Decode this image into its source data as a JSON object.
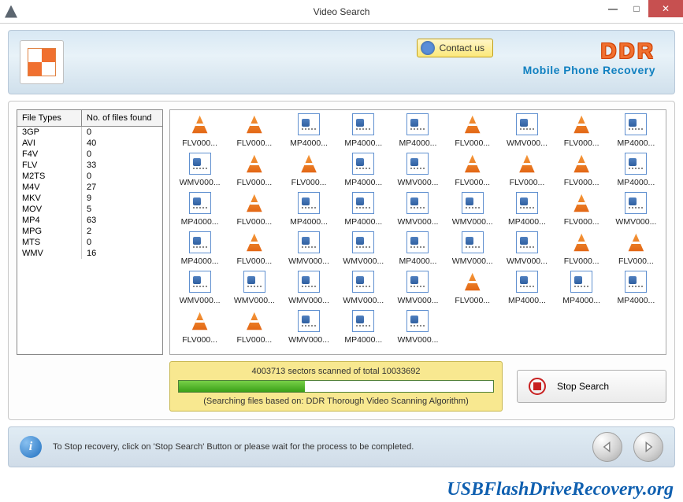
{
  "window": {
    "title": "Video Search"
  },
  "banner": {
    "contact_label": "Contact us",
    "brand_main": "DDR",
    "brand_sub": "Mobile Phone Recovery"
  },
  "file_types": {
    "header_type": "File Types",
    "header_count": "No. of files found",
    "rows": [
      {
        "type": "3GP",
        "count": "0"
      },
      {
        "type": "AVI",
        "count": "40"
      },
      {
        "type": "F4V",
        "count": "0"
      },
      {
        "type": "FLV",
        "count": "33"
      },
      {
        "type": "M2TS",
        "count": "0"
      },
      {
        "type": "M4V",
        "count": "27"
      },
      {
        "type": "MKV",
        "count": "9"
      },
      {
        "type": "MOV",
        "count": "5"
      },
      {
        "type": "MP4",
        "count": "63"
      },
      {
        "type": "MPG",
        "count": "2"
      },
      {
        "type": "MTS",
        "count": "0"
      },
      {
        "type": "WMV",
        "count": "16"
      }
    ]
  },
  "files_grid": [
    {
      "icon": "cone",
      "label": "FLV000..."
    },
    {
      "icon": "cone",
      "label": "FLV000..."
    },
    {
      "icon": "doc",
      "label": "MP4000..."
    },
    {
      "icon": "doc",
      "label": "MP4000..."
    },
    {
      "icon": "doc",
      "label": "MP4000..."
    },
    {
      "icon": "cone",
      "label": "FLV000..."
    },
    {
      "icon": "doc",
      "label": "WMV000..."
    },
    {
      "icon": "cone",
      "label": "FLV000..."
    },
    {
      "icon": "doc",
      "label": "MP4000..."
    },
    {
      "icon": "doc",
      "label": "WMV000..."
    },
    {
      "icon": "cone",
      "label": "FLV000..."
    },
    {
      "icon": "cone",
      "label": "FLV000..."
    },
    {
      "icon": "doc",
      "label": "MP4000..."
    },
    {
      "icon": "doc",
      "label": "WMV000..."
    },
    {
      "icon": "cone",
      "label": "FLV000..."
    },
    {
      "icon": "cone",
      "label": "FLV000..."
    },
    {
      "icon": "cone",
      "label": "FLV000..."
    },
    {
      "icon": "doc",
      "label": "MP4000..."
    },
    {
      "icon": "doc",
      "label": "MP4000..."
    },
    {
      "icon": "cone",
      "label": "FLV000..."
    },
    {
      "icon": "doc",
      "label": "MP4000..."
    },
    {
      "icon": "doc",
      "label": "MP4000..."
    },
    {
      "icon": "doc",
      "label": "WMV000..."
    },
    {
      "icon": "doc",
      "label": "WMV000..."
    },
    {
      "icon": "doc",
      "label": "MP4000..."
    },
    {
      "icon": "cone",
      "label": "FLV000..."
    },
    {
      "icon": "doc",
      "label": "WMV000..."
    },
    {
      "icon": "doc",
      "label": "MP4000..."
    },
    {
      "icon": "cone",
      "label": "FLV000..."
    },
    {
      "icon": "doc",
      "label": "WMV000..."
    },
    {
      "icon": "doc",
      "label": "WMV000..."
    },
    {
      "icon": "doc",
      "label": "MP4000..."
    },
    {
      "icon": "doc",
      "label": "WMV000..."
    },
    {
      "icon": "doc",
      "label": "WMV000..."
    },
    {
      "icon": "cone",
      "label": "FLV000..."
    },
    {
      "icon": "cone",
      "label": "FLV000..."
    },
    {
      "icon": "doc",
      "label": "WMV000..."
    },
    {
      "icon": "doc",
      "label": "WMV000..."
    },
    {
      "icon": "doc",
      "label": "WMV000..."
    },
    {
      "icon": "doc",
      "label": "WMV000..."
    },
    {
      "icon": "doc",
      "label": "WMV000..."
    },
    {
      "icon": "cone",
      "label": "FLV000..."
    },
    {
      "icon": "doc",
      "label": "MP4000..."
    },
    {
      "icon": "doc",
      "label": "MP4000..."
    },
    {
      "icon": "doc",
      "label": "MP4000..."
    },
    {
      "icon": "cone",
      "label": "FLV000..."
    },
    {
      "icon": "cone",
      "label": "FLV000..."
    },
    {
      "icon": "doc",
      "label": "WMV000..."
    },
    {
      "icon": "doc",
      "label": "MP4000..."
    },
    {
      "icon": "doc",
      "label": "WMV000..."
    }
  ],
  "progress": {
    "label": "4003713 sectors scanned of total 10033692",
    "percent": 40,
    "sub": "(Searching files based on:  DDR Thorough Video Scanning Algorithm)"
  },
  "stop_button": {
    "label": "Stop Search"
  },
  "footer": {
    "text": "To Stop recovery, click on 'Stop Search' Button or please wait for the process to be completed."
  },
  "footer_url": "USBFlashDriveRecovery.org"
}
